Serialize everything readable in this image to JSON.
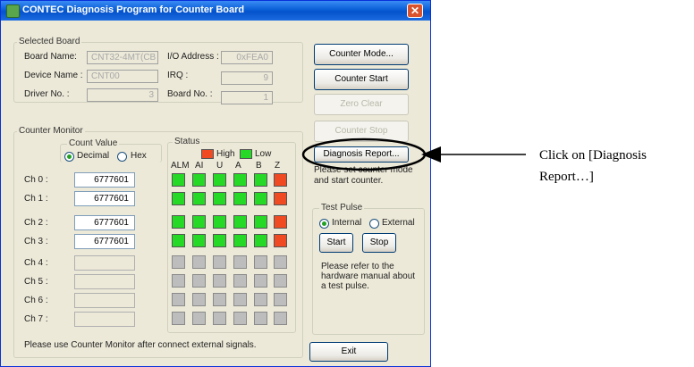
{
  "window": {
    "title": "CONTEC Diagnosis Program for Counter Board",
    "close_glyph": "✕"
  },
  "selected_board": {
    "legend": "Selected Board",
    "board_name_label": "Board Name:",
    "board_name": "CNT32-4MT(CB",
    "device_name_label": "Device Name :",
    "device_name": "CNT00",
    "driver_no_label": "Driver No. :",
    "driver_no": "3",
    "io_address_label": "I/O Address :",
    "io_address": "0xFEA0",
    "irq_label": "IRQ      :",
    "irq": "9",
    "board_no_label": "Board No. :",
    "board_no": "1"
  },
  "counter_monitor": {
    "legend": "Counter Monitor",
    "count_value_label": "Count Value",
    "decimal_label": "Decimal",
    "hex_label": "Hex",
    "decimal_selected": true,
    "channels": [
      {
        "label": "Ch 0 :",
        "value": "6777601",
        "active": true
      },
      {
        "label": "Ch 1 :",
        "value": "6777601",
        "active": true
      },
      {
        "label": "Ch 2 :",
        "value": "6777601",
        "active": true
      },
      {
        "label": "Ch 3 :",
        "value": "6777601",
        "active": true
      },
      {
        "label": "Ch 4 :",
        "value": "",
        "active": false
      },
      {
        "label": "Ch 5 :",
        "value": "",
        "active": false
      },
      {
        "label": "Ch 6 :",
        "value": "",
        "active": false
      },
      {
        "label": "Ch 7 :",
        "value": "",
        "active": false
      }
    ],
    "status": {
      "legend": "Status",
      "high_label": "High",
      "low_label": "Low",
      "high_color": "#ef4a22",
      "low_color": "#26d926",
      "columns": [
        "ALM",
        "AI",
        "U",
        "A",
        "B",
        "Z"
      ],
      "rows": [
        [
          "low",
          "low",
          "low",
          "low",
          "low",
          "high"
        ],
        [
          "low",
          "low",
          "low",
          "low",
          "low",
          "high"
        ],
        [
          "low",
          "low",
          "low",
          "low",
          "low",
          "high"
        ],
        [
          "low",
          "low",
          "low",
          "low",
          "low",
          "high"
        ],
        [
          "off",
          "off",
          "off",
          "off",
          "off",
          "off"
        ],
        [
          "off",
          "off",
          "off",
          "off",
          "off",
          "off"
        ],
        [
          "off",
          "off",
          "off",
          "off",
          "off",
          "off"
        ],
        [
          "off",
          "off",
          "off",
          "off",
          "off",
          "off"
        ]
      ]
    },
    "footer_note": "Please use Counter Monitor after connect external signals."
  },
  "buttons": {
    "counter_mode": "Counter Mode...",
    "counter_start": "Counter Start",
    "zero_clear": "Zero Clear",
    "counter_stop": "Counter Stop",
    "diagnosis_report": "Diagnosis Report...",
    "exit": "Exit"
  },
  "hint": "Please set counter mode and start counter.",
  "test_pulse": {
    "legend": "Test Pulse",
    "internal_label": "Internal",
    "external_label": "External",
    "internal_selected": true,
    "start_label": "Start",
    "stop_label": "Stop",
    "note": "Please refer to the hardware manual about a test pulse."
  },
  "annotation": {
    "line1": "Click on [Diagnosis",
    "line2": "Report…]"
  }
}
